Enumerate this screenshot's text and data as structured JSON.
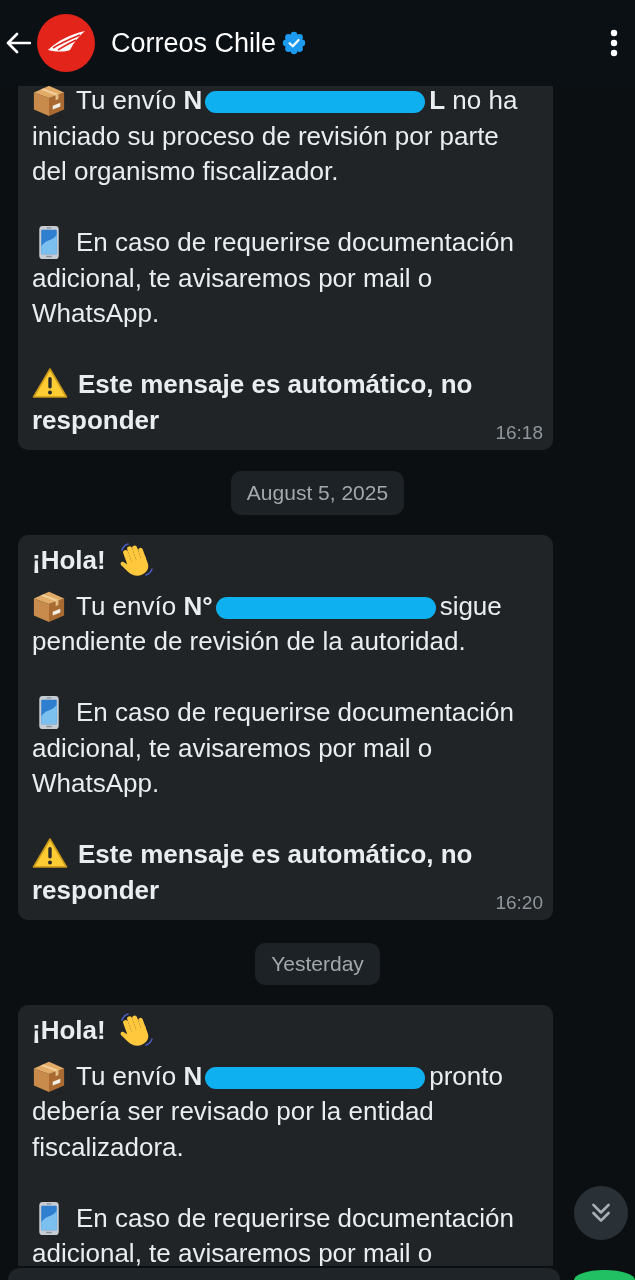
{
  "header": {
    "title": "Correos Chile",
    "verified": true
  },
  "messages": [
    {
      "kind": "bubble",
      "paragraphs": [
        {
          "kind": "shipment",
          "text_before": "Tu envío **N**",
          "redacted": true,
          "text_after": "**L** no ha iniciado su proceso de revisión por parte del organismo fiscalizador."
        },
        {
          "kind": "contact",
          "text": "En caso de requerirse documentación adicional, te avisaremos por mail o WhatsApp."
        },
        {
          "kind": "warning",
          "text": "Este mensaje es automático, no responder"
        }
      ],
      "time": "16:18"
    },
    {
      "kind": "date",
      "label": "August 5, 2025"
    },
    {
      "kind": "bubble",
      "paragraphs": [
        {
          "kind": "greeting",
          "text": "¡Hola!"
        },
        {
          "kind": "shipment",
          "text_before": "Tu envío **N°**",
          "redacted": true,
          "text_after": "sigue pendiente de revisión de la autoridad."
        },
        {
          "kind": "contact",
          "text": "En caso de requerirse documentación adicional, te avisaremos por mail o WhatsApp."
        },
        {
          "kind": "warning",
          "text": "Este mensaje es automático, no responder"
        }
      ],
      "time": "16:20"
    },
    {
      "kind": "date",
      "label": "Yesterday"
    },
    {
      "kind": "bubble",
      "paragraphs": [
        {
          "kind": "greeting",
          "text": "¡Hola!"
        },
        {
          "kind": "shipment",
          "text_before": "Tu envío **N**",
          "redacted": true,
          "text_after": "pronto debería ser revisado por la entidad fiscalizadora."
        },
        {
          "kind": "contact",
          "text": "En caso de requerirse documentación adicional, te avisaremos por mail o"
        }
      ]
    }
  ]
}
